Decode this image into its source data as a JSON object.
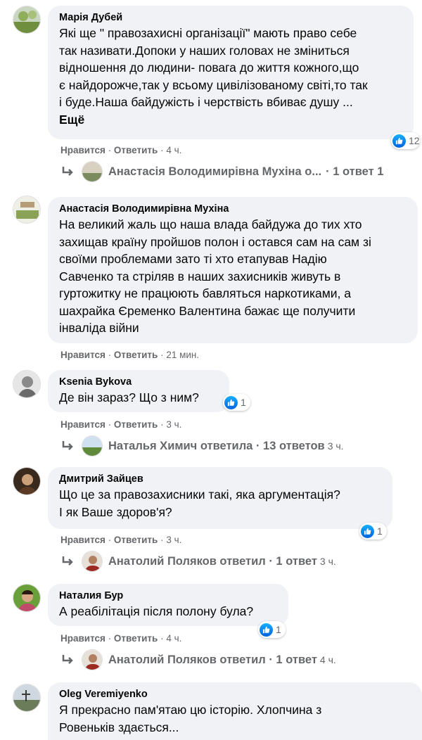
{
  "comments": [
    {
      "author": "Марія Дубей",
      "lines": [
        "Які ще \" правозахисні організації\" мають право себе",
        "так називати.Допоки у наших головах не зміниться",
        "відношення до людини- повага до життя кожного,що",
        "є найдорожче,так у всьому цивілізованому світі,то так",
        "і буде.Наша байдужість і черствість вбиває душу ..."
      ],
      "more": "Ещё",
      "like": "Нравится",
      "reply": "Ответить",
      "time": "4 ч.",
      "reactions": "12",
      "replies": {
        "text": "Анастасія Володимирівна Мухіна о...",
        "count": "· 1 ответ 1"
      }
    },
    {
      "author": "Анастасія Володимирівна Мухіна",
      "lines": [
        "На великий жаль що наша влада байдужа до тих хто",
        "захищав країну пройшов полон і остався сам на сам зі",
        "своїми проблемами зато ті хто етапував Надію",
        "Савченко та стріляв в наших захисників живуть в",
        "гуртожитку не працюють бавляться наркотиками, а",
        "шахрайка Єременко Валентина бажає ще получити",
        "інваліда війни"
      ],
      "like": "Нравится",
      "reply": "Ответить",
      "time": "21 мин."
    },
    {
      "author": "Ksenia Bykova",
      "lines": [
        "Де він зараз? Що з ним?"
      ],
      "like": "Нравится",
      "reply": "Ответить",
      "time": "3 ч.",
      "reactions": "1",
      "replies": {
        "text": "Наталья Химич ответила · 13 ответов",
        "time": "3 ч."
      }
    },
    {
      "author": "Дмитрий Зайцев",
      "lines": [
        "Що це за правозахисники такі, яка аргументація?",
        "І як Ваше здоров'я?"
      ],
      "like": "Нравится",
      "reply": "Ответить",
      "time": "3 ч.",
      "reactions": "1",
      "replies": {
        "text": "Анатолий Поляков ответил · 1 ответ",
        "time": "3 ч."
      }
    },
    {
      "author": "Наталия Бур",
      "lines": [
        "А реабілітація після полону була?"
      ],
      "like": "Нравится",
      "reply": "Ответить",
      "time": "4 ч.",
      "reactions": "1",
      "replies": {
        "text": "Анатолий Поляков ответил · 1 ответ",
        "time": "4 ч."
      }
    },
    {
      "author": "Oleg Veremiyenko",
      "lines": [
        "Я прекрасно пам'ятаю цю історію. Хлопчина з",
        "Ровеньків здається..."
      ]
    }
  ],
  "sep": " · ",
  "colors": {
    "like_blue": "#1877f2",
    "bubble": "#f0f2f5",
    "meta": "#65676b"
  }
}
